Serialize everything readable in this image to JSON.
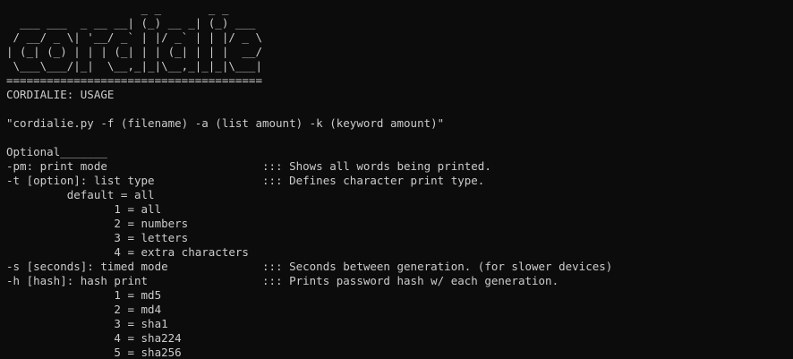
{
  "banner": [
    "                    _ _       _ _      ",
    "  ___ ___  _ __ __| (_) __ _| (_) ___ ",
    " / __/ _ \\| '__/ _` | |/ _` | | |/ _ \\",
    "| (_| (_) | | | (_| | | (_| | | |  __/",
    " \\___\\___/|_|  \\__,_|_|\\__,_|_|_|\\___|",
    "======================================"
  ],
  "lines": [
    "CORDIALIE: USAGE",
    "",
    "\"cordialie.py -f (filename) -a (list amount) -k (keyword amount)\"",
    "",
    "Optional_______",
    "-pm: print mode                       ::: Shows all words being printed.",
    "-t [option]: list type                ::: Defines character print type.",
    "         default = all",
    "                1 = all",
    "                2 = numbers",
    "                3 = letters",
    "                4 = extra characters",
    "-s [seconds]: timed mode              ::: Seconds between generation. (for slower devices)",
    "-h [hash]: hash print                 ::: Prints password hash w/ each generation.",
    "                1 = md5",
    "                2 = md4",
    "                3 = sha1",
    "                4 = sha224",
    "                5 = sha256"
  ],
  "colors": {
    "background": "#0c0c0c",
    "foreground": "#cccccc"
  }
}
